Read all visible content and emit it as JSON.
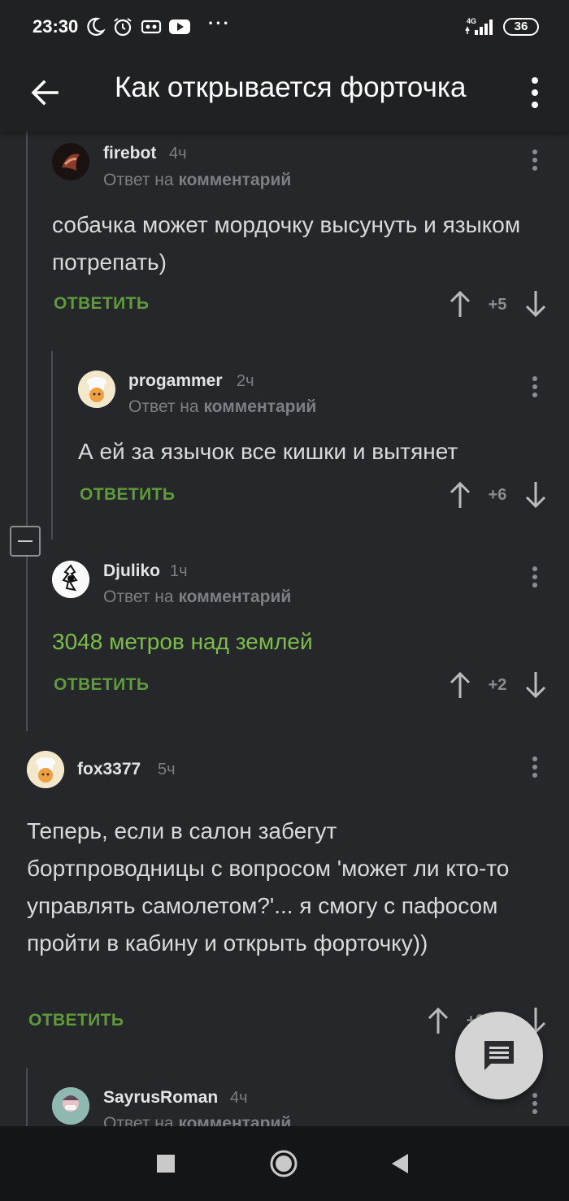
{
  "status_bar": {
    "time": "23:30",
    "network": "4G",
    "battery": "36",
    "more": "···",
    "icons": [
      "moon-icon",
      "alarm-icon",
      "vr-icon",
      "youtube-icon",
      "signal-icon",
      "battery-icon"
    ]
  },
  "app_bar": {
    "title": "Как открывается форточка",
    "back_icon": "arrow-left-icon",
    "menu_icon": "more-vertical-icon"
  },
  "comments": [
    {
      "username": "firebot",
      "time": "4ч",
      "reply_prefix": "Ответ на",
      "reply_target": "комментарий",
      "text": "собачка может мордочку высунуть и языком потрепать)",
      "reply_label": "ОТВЕТИТЬ",
      "score": "+5"
    },
    {
      "username": "progammer",
      "time": "2ч",
      "reply_prefix": "Ответ на",
      "reply_target": "комментарий",
      "text": "А ей за язычок все кишки и вытянет",
      "reply_label": "ОТВЕТИТЬ",
      "score": "+6"
    },
    {
      "username": "Djuliko",
      "time": "1ч",
      "reply_prefix": "Ответ на",
      "reply_target": "комментарий",
      "text": "3048 метров над землей",
      "reply_label": "ОТВЕТИТЬ",
      "score": "+2"
    },
    {
      "username": "fox3377",
      "time": "5ч",
      "text": "Теперь, если в салон забегут бортпроводницы с вопросом 'может ли кто-то управлять самолетом?'... я смогу с пафосом пройти в кабину и открыть форточку))",
      "reply_label": "ОТВЕТИТЬ",
      "score": "+9"
    },
    {
      "username": "SayrusRoman",
      "time": "4ч",
      "reply_prefix": "Ответ на",
      "reply_target": "комментарий"
    }
  ],
  "colors": {
    "background": "#25272a",
    "bar": "#1f2123",
    "accent_green": "#5f9a3b",
    "text_green": "#7cbd4a"
  }
}
